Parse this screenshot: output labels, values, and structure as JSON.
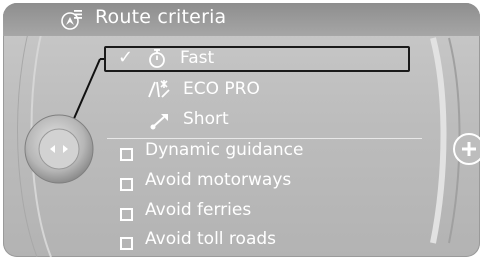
{
  "window": {
    "title": "Route criteria",
    "title_icon": "route-settings-icon"
  },
  "route_options": [
    {
      "label": "Fast",
      "icon": "stopwatch-icon",
      "selected": true,
      "check": "✓"
    },
    {
      "label": "ECO PRO",
      "icon": "eco-route-icon",
      "selected": false
    },
    {
      "label": "Short",
      "icon": "short-route-icon",
      "selected": false
    }
  ],
  "checkbox_options": [
    {
      "label": "Dynamic guidance",
      "checked": false
    },
    {
      "label": "Avoid motorways",
      "checked": false
    },
    {
      "label": "Avoid ferries",
      "checked": false
    },
    {
      "label": "Avoid toll roads",
      "checked": false
    }
  ],
  "controls": {
    "knob_icon": "controller-knob-icon",
    "right_button_icon": "plus-icon"
  }
}
